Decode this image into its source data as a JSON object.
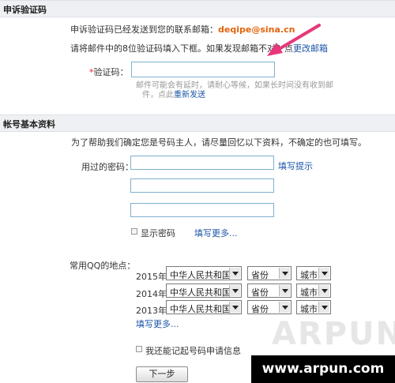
{
  "appeal": {
    "title": "申诉验证码",
    "sent_notice": "申诉验证码已经发送到您的联系邮箱：",
    "email": "deqipe@sina.cn",
    "instruction": "请将邮件中的8位验证码填入下框。如果发现邮箱不对？",
    "instruction_link_prefix": "点",
    "change_email_link": "更改邮箱",
    "code_label": "验证码：",
    "required_mark": "*",
    "code_value": "",
    "hint_line1": "邮件可能会有延时，请耐心等候，如果长时间没有收到邮",
    "hint_line2_prefix": "件，点此",
    "resend_link": "重新发送"
  },
  "account": {
    "title": "帐号基本资料",
    "intro": "为了帮助我们确定您是号码主人，请尽量回忆以下资料，不确定的也可填写。",
    "password_label": "用过的密码：",
    "password_values": [
      "",
      "",
      ""
    ],
    "fill_hint_link": "填写提示",
    "show_password_label": "显示密码",
    "fill_more_link_1": "填写更多...",
    "qq_location_label": "常用QQ的地点：",
    "locations": [
      {
        "year": "2015年",
        "country": "中华人民共和国",
        "province": "省份",
        "city": "城市"
      },
      {
        "year": "2014年",
        "country": "中华人民共和国",
        "province": "省份",
        "city": "城市"
      },
      {
        "year": "2013年",
        "country": "中华人民共和国",
        "province": "省份",
        "city": "城市"
      }
    ],
    "fill_more_link_2": "填写更多...",
    "remember_info_label": "我还能记起号码申请信息",
    "next_button": "下一步"
  },
  "watermark": {
    "logo_text": "ARPUN",
    "url_text": "www.arpun.com"
  },
  "colors": {
    "email": "#e2640c",
    "link": "#1a55a6",
    "arrow": "#e8367a",
    "section_bar": "#eef0f3"
  }
}
